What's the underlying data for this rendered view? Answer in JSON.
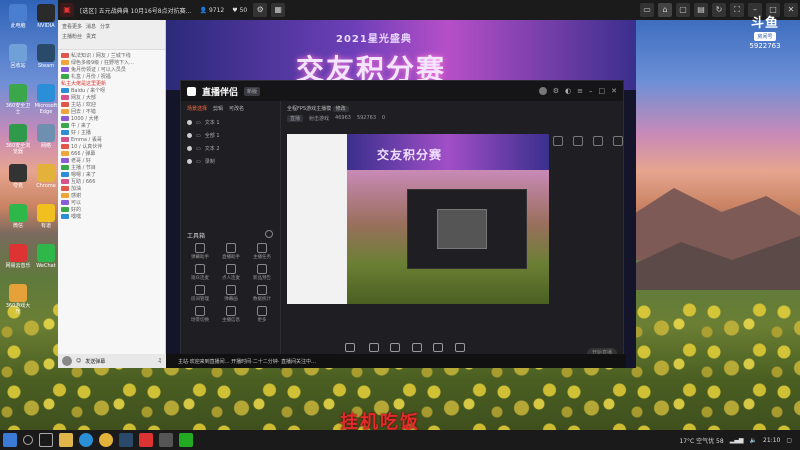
{
  "topbar": {
    "title": "[选区] 五元战典典 10月16号8点对抗赛…",
    "count1": "9712",
    "count2": "50"
  },
  "desktop_icons": [
    {
      "label": "此电脑"
    },
    {
      "label": "NVIDIA"
    },
    {
      "label": "回收站"
    },
    {
      "label": "Steam"
    },
    {
      "label": "360安全卫士"
    },
    {
      "label": "Microsoft Edge"
    },
    {
      "label": "360安全浏览器"
    },
    {
      "label": "网络"
    },
    {
      "label": "夸克"
    },
    {
      "label": "Chrome"
    },
    {
      "label": "微信"
    },
    {
      "label": "有道"
    },
    {
      "label": "网易云音乐"
    },
    {
      "label": "WeChat"
    },
    {
      "label": "360游戏大厅"
    }
  ],
  "chat": {
    "header_row1": [
      "查看更多",
      "消息",
      "分享"
    ],
    "header_row2": [
      "主播粉丝",
      "贵宾"
    ],
    "messages": [
      "私法知识 / 网友 / 兰城下线",
      "绿色多级9级 / 狂野地下入…",
      "兔月份领证 / 可以入员员",
      "礼盒 / 月份 / 祝福",
      "Baidu / 来个呀",
      "网友 / 大部",
      "主站 / 欢迎",
      "回去 / 不错",
      "1000 / 大佬",
      "牛 / 来了",
      "好 / 主播",
      "Emma / 丢哥",
      "10 / 认真伙伴",
      "666 / 弹幕",
      "老哥 / 好",
      "主播 / 节目",
      "嗯嗯 / 来了",
      "互助 / 666",
      "加油",
      "感谢",
      "可以",
      "好的",
      "嘿嘿"
    ],
    "highlight": "私主大佬是这里更新",
    "footer_label": "发送弹幕"
  },
  "banner": {
    "subtitle": "2021星光盛典",
    "title": "交友积分赛"
  },
  "obs": {
    "app_title": "直播伴侣",
    "app_tag": "新版",
    "tabs": [
      "场景选择",
      "剪辑",
      "可改名"
    ],
    "scenes": [
      "文本 1",
      "全部 1",
      "文本 2",
      "录制"
    ],
    "tools_title": "工具箱",
    "tools": [
      "弹幕助手",
      "直播助手",
      "主播任务",
      "观众连麦",
      "点人连麦",
      "新品预告",
      "房间管理",
      "弹幕画",
      "数据统计",
      "场景切换",
      "主播信息",
      "更多"
    ],
    "room_title": "全程FPS游戏主播模",
    "room_tag": "修改",
    "info_items": [
      "直播",
      "射击游戏",
      "46963",
      "592763",
      "0"
    ],
    "bottom_buttons": [
      "直播屏幕",
      "摄像头",
      "多场景",
      "多画面",
      "麦克风",
      "扬声器"
    ],
    "go_live": "开始直播",
    "preview_title": "交友积分赛"
  },
  "stream_status": "主站·欢迎来到直播间…    开播时间·二十二分钟·    直播间关注中…",
  "douyu": {
    "logo": "斗鱼",
    "tag": "房间号",
    "room_number": "5922763"
  },
  "caption": "挂机吃饭",
  "taskbar": {
    "weather": "17°C 空气优 58",
    "time": "21:10"
  },
  "colors": {
    "accent": "#ff6b3d",
    "caption": "#e42a2a",
    "topbar_bg": "#1b1b1b",
    "obs_bg": "#1f1f23"
  }
}
